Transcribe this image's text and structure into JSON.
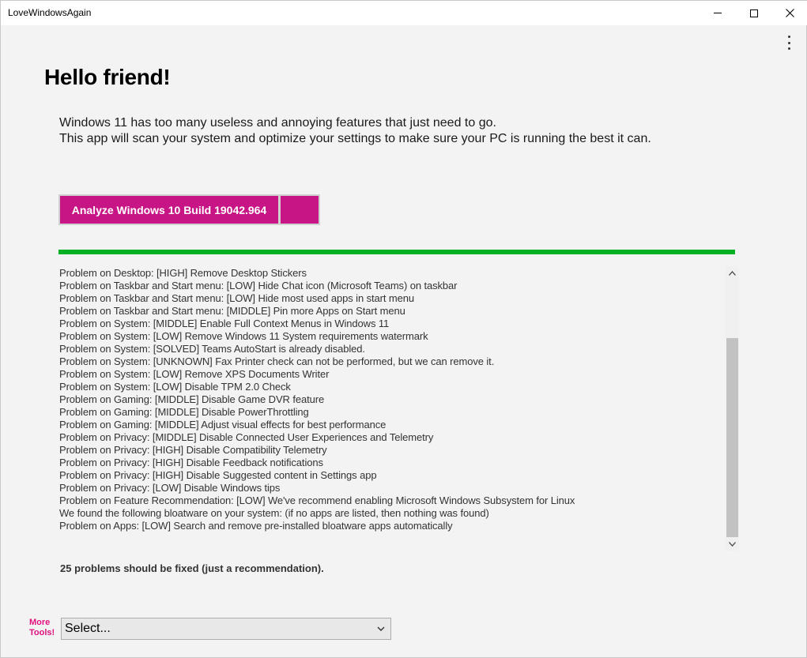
{
  "window": {
    "title": "LoveWindowsAgain"
  },
  "header": {
    "greeting": "Hello friend!",
    "intro_line_1": "Windows 11 has too many useless and annoying features that just need to go.",
    "intro_line_2": "This app will scan your system and optimize your settings to make sure your PC is running the best it can."
  },
  "actions": {
    "analyze_label": "Analyze Windows 10 Build 19042.964",
    "accent_color": "#c71585"
  },
  "progress": {
    "value": 1.0,
    "color": "#06b025"
  },
  "log": {
    "lines": [
      "Problem on Desktop: [HIGH] Remove Desktop Stickers",
      "Problem on Taskbar and Start menu: [LOW] Hide Chat icon (Microsoft Teams) on taskbar",
      "Problem on Taskbar and Start menu: [LOW] Hide most used apps in start menu",
      "Problem on Taskbar and Start menu: [MIDDLE] Pin more Apps on Start menu",
      "Problem on System: [MIDDLE] Enable Full Context Menus in Windows 11",
      "Problem on System: [LOW] Remove Windows 11 System requirements watermark",
      "Problem on System: [SOLVED] Teams AutoStart is already disabled.",
      "Problem on System: [UNKNOWN] Fax Printer check can not be performed, but we can remove it.",
      "Problem on System: [LOW] Remove XPS Documents Writer",
      "Problem on System: [LOW] Disable TPM 2.0 Check",
      "Problem on Gaming: [MIDDLE] Disable Game DVR feature",
      "Problem on Gaming: [MIDDLE] Disable PowerThrottling",
      "Problem on Gaming: [MIDDLE] Adjust visual effects for best performance",
      "Problem on Privacy: [MIDDLE] Disable Connected User Experiences and Telemetry",
      "Problem on Privacy: [HIGH] Disable Compatibility Telemetry",
      "Problem on Privacy: [HIGH] Disable Feedback notifications",
      "Problem on Privacy: [HIGH] Disable Suggested content in Settings app",
      "Problem on Privacy: [LOW] Disable Windows tips",
      "Problem on Feature Recommendation: [LOW] We've recommend enabling Microsoft Windows Subsystem for Linux",
      "We found the following bloatware on your system: (if no apps are listed, then nothing was found)",
      "Problem on Apps: [LOW] Search and remove pre-installed bloatware apps automatically"
    ]
  },
  "summary": {
    "text": "25 problems should be fixed (just a recommendation)."
  },
  "tools": {
    "label_line_1": "More",
    "label_line_2": "Tools!",
    "select_value": "Select...",
    "label_color": "#e0117f"
  },
  "icons": {
    "minimize": "minimize-icon",
    "maximize": "maximize-icon",
    "close": "close-icon",
    "menu": "more-vertical-icon",
    "scroll_up": "chevron-up-icon",
    "scroll_down": "chevron-down-icon",
    "dropdown": "chevron-down-icon"
  }
}
